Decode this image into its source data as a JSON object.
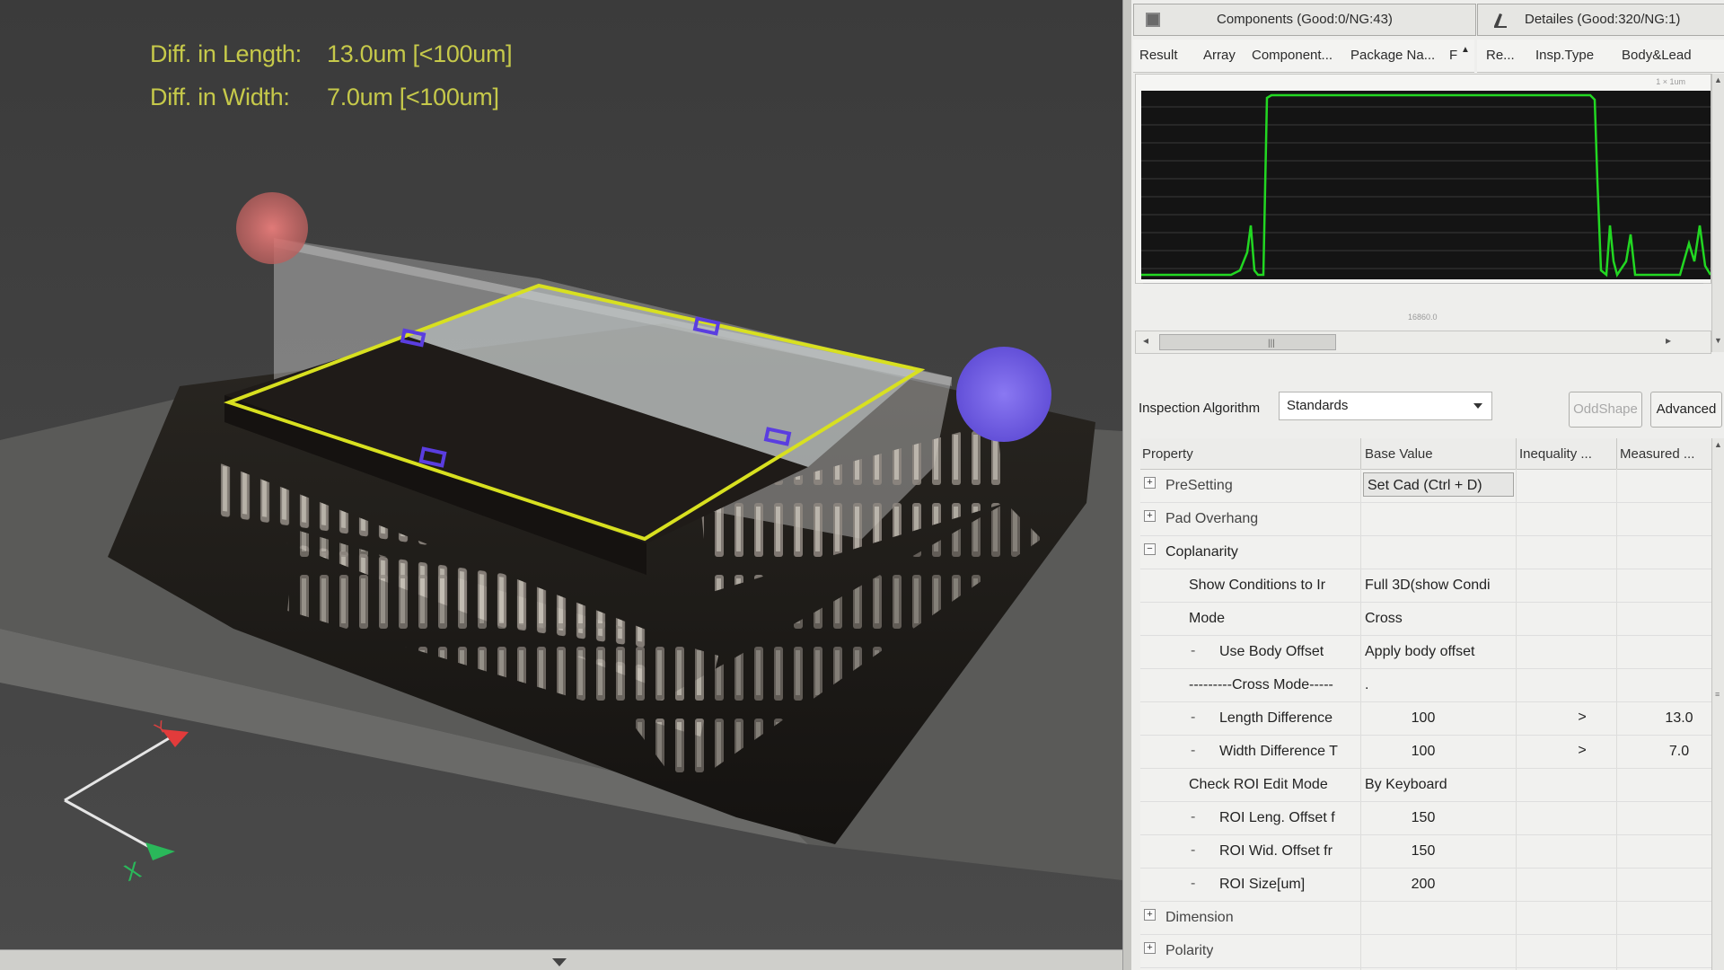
{
  "overlay": {
    "length_label": "Diff. in Length:",
    "length_value": "13.0um [<100um]",
    "width_label": "Diff. in Width:",
    "width_value": "7.0um [<100um]"
  },
  "colors": {
    "overlay_text": "#c6c94a",
    "roi_outline": "#d8e020",
    "graph_trace": "#22d722",
    "marker_red": "#d46b6b",
    "marker_blue": "#7b68e8"
  },
  "left_panel": {
    "tab_title": "Components (Good:0/NG:43)",
    "tab_icon": "grid-icon",
    "columns": [
      "Result",
      "Array",
      "Component...",
      "Package Na...",
      "F"
    ]
  },
  "right_tab": {
    "tab_title": "Detailes (Good:320/NG:1)",
    "tab_icon": "pen-icon",
    "columns": [
      "Re...",
      "Insp.Type",
      "Body&Lead"
    ]
  },
  "graph": {
    "x_axis_label": "16860.0",
    "top_right_label": "1 × 1um"
  },
  "inspection": {
    "label": "Inspection Algorithm",
    "selected": "Standards",
    "oddshape_label": "OddShape",
    "advanced_label": "Advanced"
  },
  "grid": {
    "headers": [
      "Property",
      "Base Value",
      "Inequality ...",
      "Measured ..."
    ],
    "rows": [
      {
        "label": "PreSetting",
        "value": "Set Cad (Ctrl + D)",
        "expander": "+"
      },
      {
        "label": "Pad Overhang",
        "expander": "+"
      },
      {
        "label": "Coplanarity",
        "expander": "−"
      },
      {
        "label": "Show Conditions to Ir",
        "value": "Full 3D(show Condi"
      },
      {
        "label": "Mode",
        "value": "Cross"
      },
      {
        "label": "Use Body Offset",
        "value": "Apply body offset",
        "dash": "-"
      },
      {
        "label": "---------Cross Mode-----",
        "value": "."
      },
      {
        "label": "Length Difference",
        "value": "100",
        "inequality": ">",
        "measured": "13.0",
        "dash": "-"
      },
      {
        "label": "Width Difference T",
        "value": "100",
        "inequality": ">",
        "measured": "7.0",
        "dash": "-"
      },
      {
        "label": "Check ROI Edit Mode",
        "value": "By Keyboard"
      },
      {
        "label": "ROI Leng. Offset f",
        "value": "150",
        "dash": "-"
      },
      {
        "label": "ROI Wid. Offset fr",
        "value": "150",
        "dash": "-"
      },
      {
        "label": "ROI Size[um]",
        "value": "200",
        "dash": "-"
      },
      {
        "label": "Dimension",
        "expander": "+"
      },
      {
        "label": "Polarity",
        "expander": "+"
      }
    ]
  },
  "axes_gizmo": {
    "x_label": "X",
    "y_label": "Y"
  }
}
